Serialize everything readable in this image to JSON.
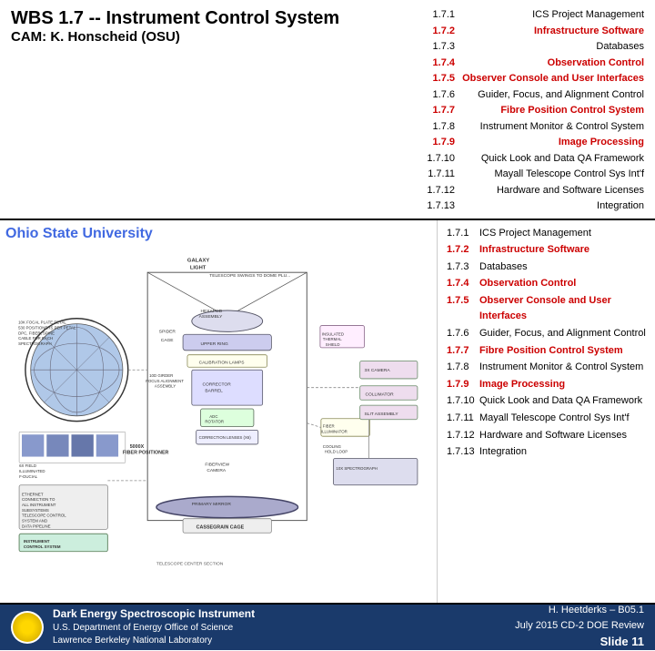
{
  "header": {
    "title": "WBS 1.7  --  Instrument Control System",
    "subtitle": "CAM: K. Honscheid (OSU)",
    "wbs_items": [
      {
        "number": "1.7.1",
        "text": "ICS Project Management",
        "highlighted": false
      },
      {
        "number": "1.7.2",
        "text": "Infrastructure Software",
        "highlighted": true
      },
      {
        "number": "1.7.3",
        "text": "Databases",
        "highlighted": false
      },
      {
        "number": "1.7.4",
        "text": "Observation Control",
        "highlighted": true
      },
      {
        "number": "1.7.5",
        "text": "Observer Console and User Interfaces",
        "highlighted": true
      },
      {
        "number": "1.7.6",
        "text": "Guider, Focus, and Alignment Control",
        "highlighted": false
      },
      {
        "number": "1.7.7",
        "text": "Fibre Position Control System",
        "highlighted": true
      },
      {
        "number": "1.7.8",
        "text": "Instrument Monitor & Control System",
        "highlighted": false
      },
      {
        "number": "1.7.9",
        "text": "Image Processing",
        "highlighted": true
      },
      {
        "number": "1.7.10",
        "text": "Quick Look and Data QA Framework",
        "highlighted": false
      },
      {
        "number": "1.7.11",
        "text": "Mayall Telescope Control Sys Int'f",
        "highlighted": false
      },
      {
        "number": "1.7.12",
        "text": "Hardware and Software Licenses",
        "highlighted": false
      },
      {
        "number": "1.7.13",
        "text": "Integration",
        "highlighted": false
      }
    ]
  },
  "left_panel": {
    "institution_label": "Ohio State University"
  },
  "footer": {
    "instrument_name": "Dark Energy Spectroscopic Instrument",
    "dept_line1": "U.S. Department of Energy Office of Science",
    "dept_line2": "Lawrence Berkeley National Laboratory",
    "credit": "H. Heetderks – B05.1",
    "date": "July 2015 CD-2 DOE Review",
    "slide": "Slide 11"
  }
}
